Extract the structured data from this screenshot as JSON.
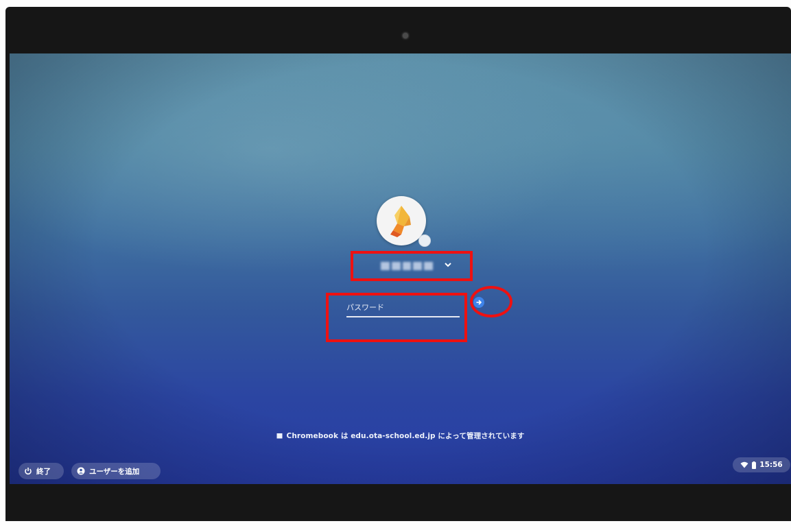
{
  "login": {
    "password_placeholder": "パスワード",
    "password_value": ""
  },
  "notice": {
    "text": "Chromebook は edu.ota-school.ed.jp によって管理されています"
  },
  "shelf": {
    "shutdown_label": "終了",
    "add_user_label": "ユーザーを追加"
  },
  "status": {
    "time": "15:56"
  },
  "colors": {
    "accent": "#3f84ea",
    "highlight_red": "#ee1111"
  },
  "icons": {
    "avatar": "origami-bird-avatar-icon",
    "chevron": "chevron-down-icon",
    "submit": "arrow-right-icon",
    "notice": "building-icon",
    "power": "power-icon",
    "add_user": "add-user-icon",
    "wifi": "wifi-icon",
    "battery": "battery-icon"
  }
}
